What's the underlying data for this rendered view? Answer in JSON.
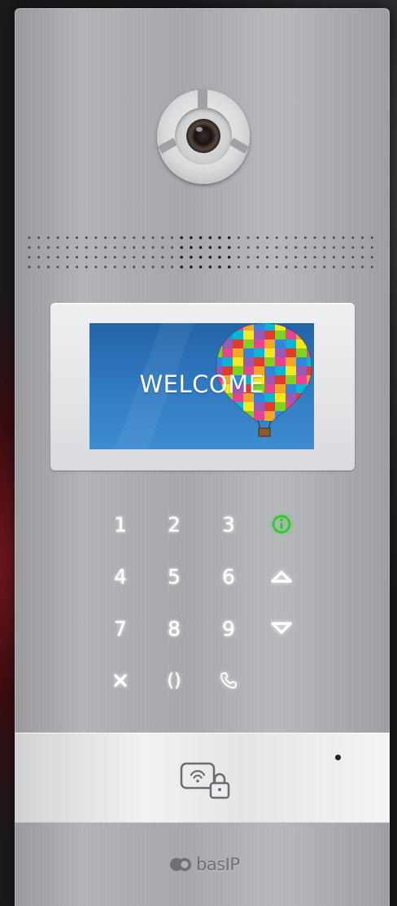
{
  "device": {
    "brand_logo": "basIP",
    "display": {
      "welcome_text": "WELCOME"
    },
    "keypad": {
      "rows": [
        [
          "1",
          "2",
          "3",
          "info-icon"
        ],
        [
          "4",
          "5",
          "6",
          "arrow-up-icon"
        ],
        [
          "7",
          "8",
          "9",
          "arrow-down-icon"
        ],
        [
          "cancel-icon",
          "0",
          "call-icon"
        ]
      ],
      "digits": {
        "k1": "1",
        "k2": "2",
        "k3": "3",
        "k4": "4",
        "k5": "5",
        "k6": "6",
        "k7": "7",
        "k8": "8",
        "k9": "9",
        "k0": "()"
      },
      "colors": {
        "key_glow": "#ffffff",
        "info_icon": "#3cc33c"
      }
    },
    "card_reader": {
      "icon": "nfc-card-lock-icon"
    },
    "colors": {
      "panel": "#a9abaf",
      "display_bg": "#2f78bf"
    }
  }
}
